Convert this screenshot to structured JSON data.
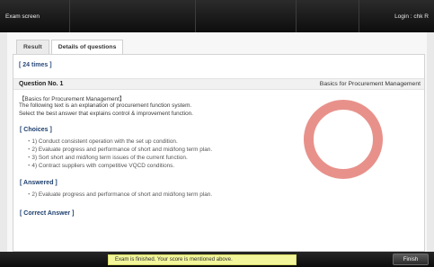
{
  "header": {
    "title": "Exam screen",
    "login": "Login : chk R"
  },
  "tabs": [
    {
      "label": "Result",
      "active": false
    },
    {
      "label": "Details of questions",
      "active": true
    }
  ],
  "times": "[ 24 times ]",
  "question": {
    "number": "Question No. 1",
    "category": "Basics for Procurement Management",
    "tag": "【Basics for Procurement Management】",
    "line1": "The following text is an explanation of procurement function system.",
    "line2": "Select the best answer that explains control & improvement function."
  },
  "choices": {
    "header": "[ Choices ]",
    "items": [
      "・1) Conduct consistent operation with the set up condition.",
      "・2) Evaluate progress and performance of short and mid/long term plan.",
      "・3) Sort short and mid/long term issues of the current function.",
      "・4) Contract suppliers with competitive VQCD conditions."
    ]
  },
  "answered": {
    "header": "[ Answered ]",
    "value": "・2) Evaluate progress and performance of short and mid/long term plan."
  },
  "correct": {
    "header": "[ Correct Answer ]"
  },
  "result_mark": {
    "icon": "correct-circle-icon",
    "color": "#e8918b"
  },
  "footer": {
    "status": "Exam is finished. Your score is mentioned above.",
    "finish_label": "Finish"
  }
}
